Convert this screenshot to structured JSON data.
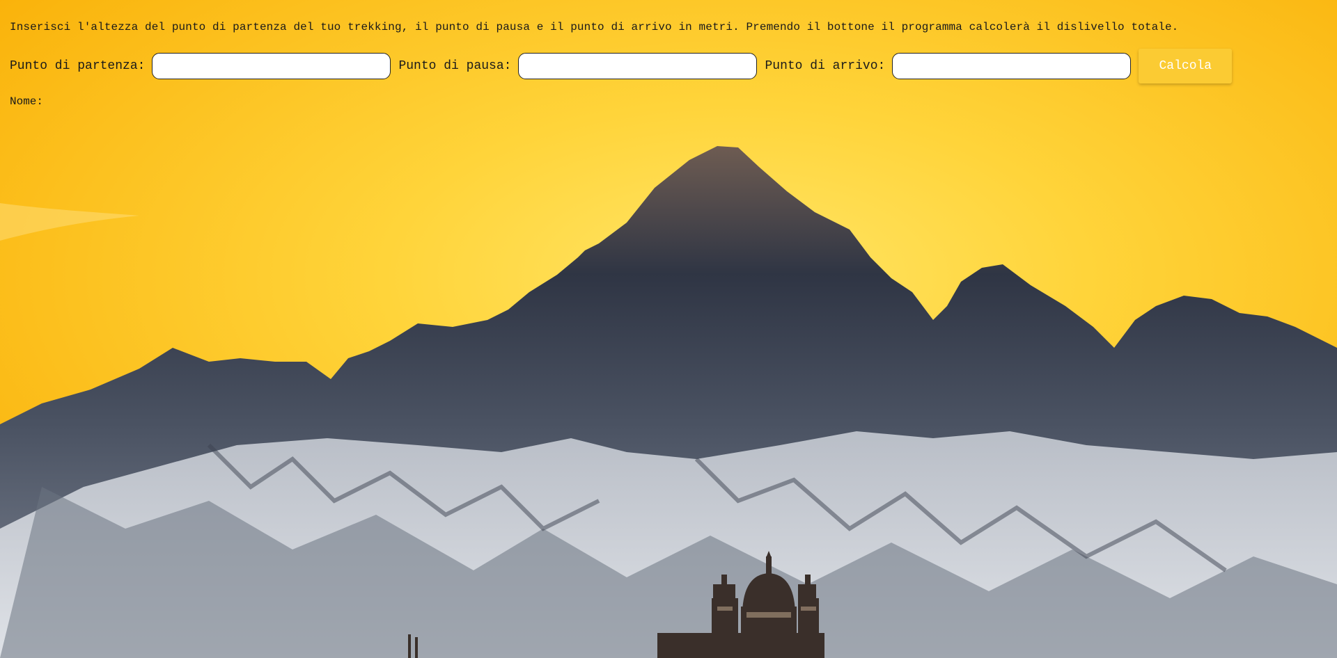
{
  "intro": {
    "text": "Inserisci l'altezza del punto di partenza del tuo trekking, il punto di pausa e il punto di arrivo in metri. Premendo il bottone il programma calcolerà il dislivello totale."
  },
  "form": {
    "start_label": "Punto di partenza:",
    "start_value": "",
    "pause_label": "Punto di pausa:",
    "pause_value": "",
    "end_label": "Punto di arrivo:",
    "end_value": "",
    "button_label": "Calcola"
  },
  "result": {
    "name_label": "Nome:",
    "name_value": ""
  },
  "colors": {
    "sky_top": "#ffbf00",
    "sky_mid": "#ffd84a",
    "button_bg": "#fbcb33",
    "snow": "#c9cdd3",
    "rock": "#3a3f4a"
  }
}
